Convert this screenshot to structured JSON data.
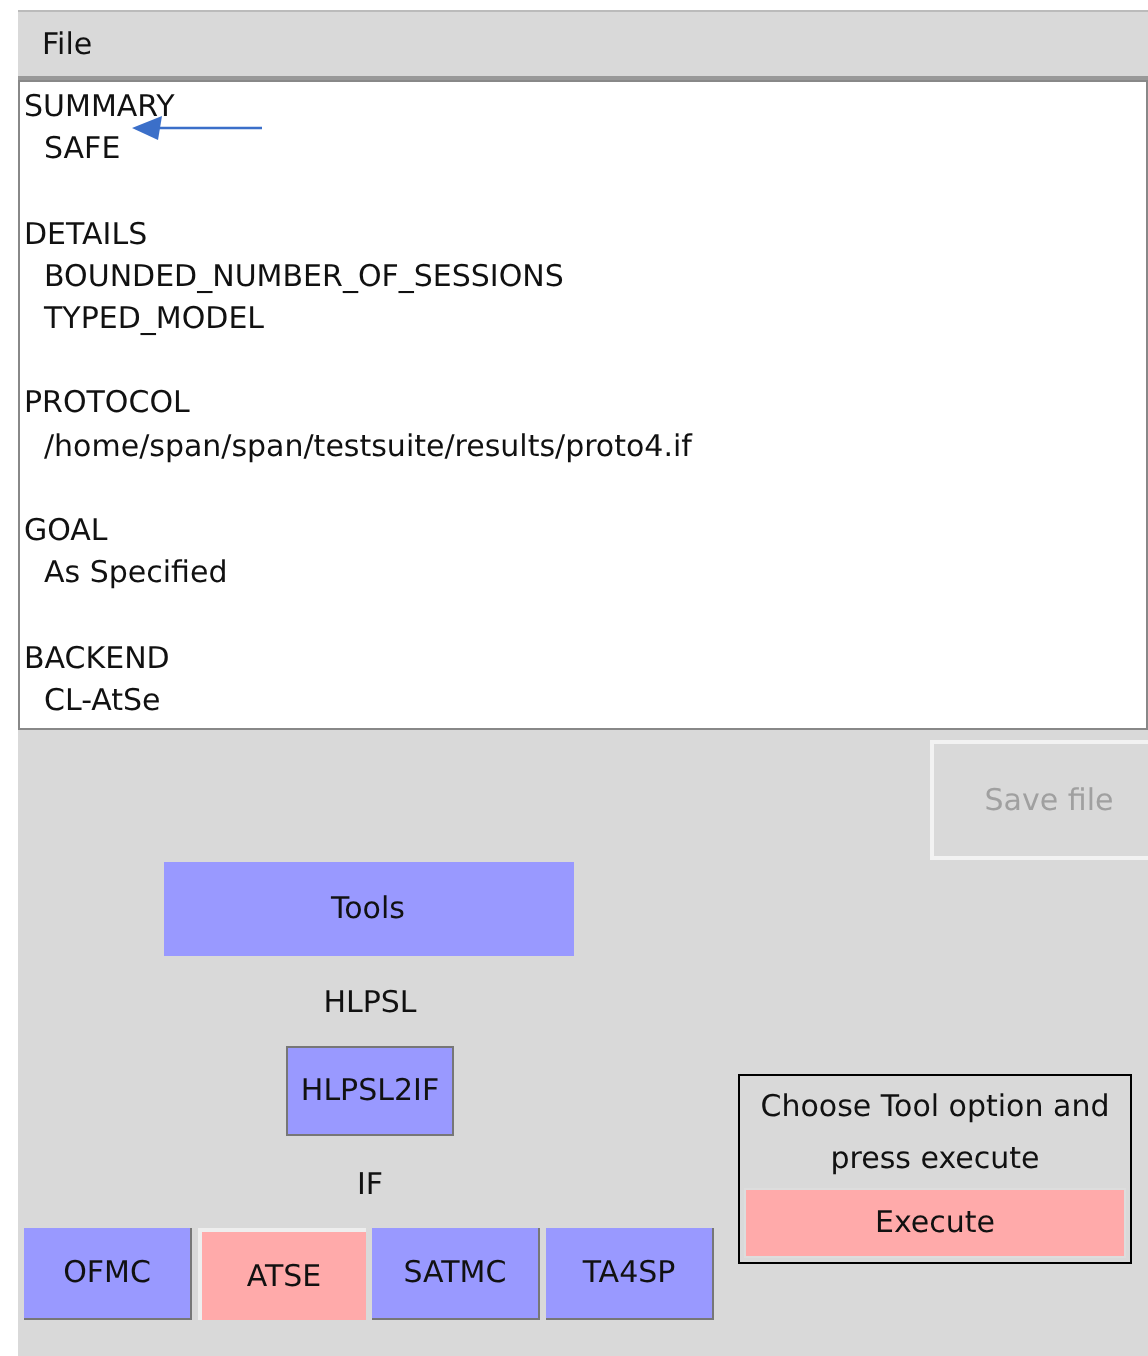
{
  "menu": [
    "File"
  ],
  "report": [
    {
      "heading": "SUMMARY",
      "lines": [
        "SAFE"
      ]
    },
    {
      "heading": "DETAILS",
      "lines": [
        "BOUNDED_NUMBER_OF_SESSIONS",
        "TYPED_MODEL"
      ]
    },
    {
      "heading": "PROTOCOL",
      "lines": [
        "/home/span/span/testsuite/results/proto4.if"
      ]
    },
    {
      "heading": "GOAL",
      "lines": [
        "As Specified"
      ]
    },
    {
      "heading": "BACKEND",
      "lines": [
        "CL-AtSe"
      ]
    }
  ],
  "save_button": {
    "label": "Save file",
    "disabled": true
  },
  "tools_button": "Tools",
  "hlpsl_label": "HLPSL",
  "translator_button": "HLPSL2IF",
  "if_label": "IF",
  "backends": [
    {
      "label": "OFMC",
      "selected": false
    },
    {
      "label": "ATSE",
      "selected": true
    },
    {
      "label": "SATMC",
      "selected": false
    },
    {
      "label": "TA4SP",
      "selected": false
    }
  ],
  "execute_panel": {
    "hint": "Choose Tool option and press execute",
    "button": "Execute"
  }
}
